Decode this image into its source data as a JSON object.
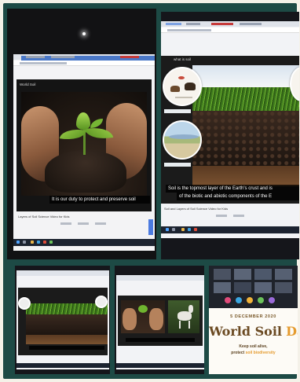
{
  "collage": {
    "photo_1": {
      "window_title": "World Soil",
      "caption": "It is our duty to protect and preserve soil",
      "footer_title": "Layers of Soil Science Video for Kids"
    },
    "photo_2": {
      "window_title": "what is soil",
      "caption_line_1": "Soil is the topmost layer of the Earth's crust and is",
      "caption_line_2": "of the biotic and abiotic components of the E",
      "footer_title": "Soil and Layers of Soil Science Video for Kids"
    },
    "photo_5": {
      "date": "5 DECEMBER 2020",
      "title_part_1": "World Soil",
      "title_part_2": "Day",
      "line_1": "Keep soil alive,",
      "line_2_part_1": "protect",
      "line_2_part_2": "soil biodiversity"
    }
  },
  "colors": {
    "frame": "#1d4a45",
    "background": "#f4f1e8",
    "wsd_brown": "#6b4a22",
    "wsd_orange": "#e59b2f"
  }
}
